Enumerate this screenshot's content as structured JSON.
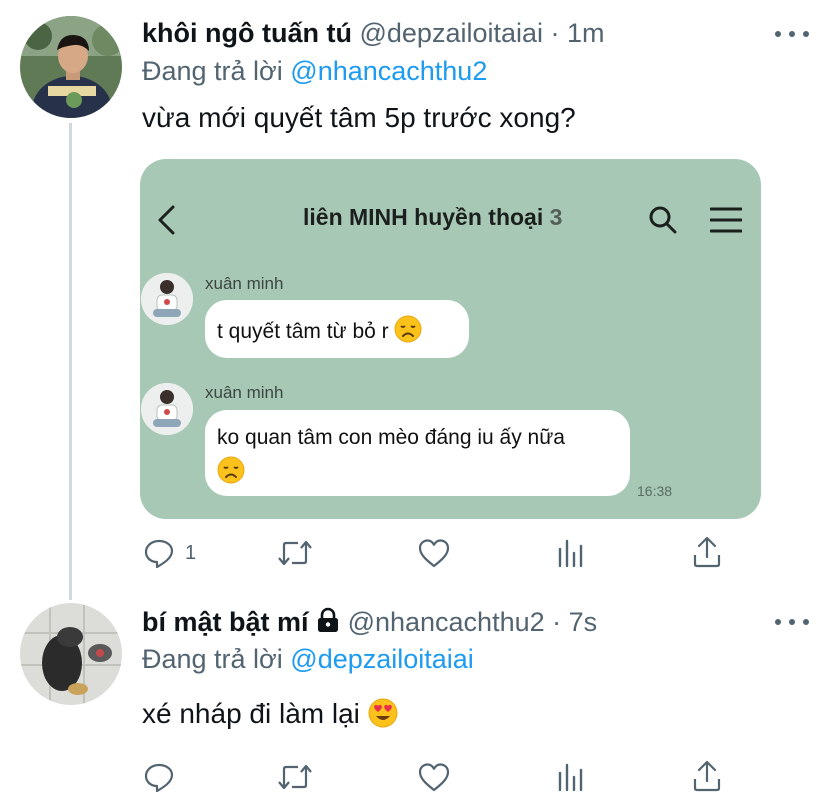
{
  "tweets": [
    {
      "author_name": "khôi ngô tuấn tú",
      "handle": "@depzailoitaiai",
      "separator": "·",
      "time": "1m",
      "replying_prefix": "Đang trả lời",
      "replying_to": "@nhancachthu2",
      "text": "vừa mới quyết tâm 5p trước xong?",
      "actions": {
        "reply_count": "1",
        "retweet_count": "",
        "like_count": ""
      }
    },
    {
      "author_name": "bí mật bật mí",
      "handle": "@nhancachthu2",
      "separator": "·",
      "time": "7s",
      "replying_prefix": "Đang trả lời",
      "replying_to": "@depzailoitaiai",
      "text": "xé nháp đi làm lại",
      "actions": {
        "reply_count": "",
        "retweet_count": "",
        "like_count": ""
      }
    }
  ],
  "chat": {
    "title": "liên MINH huyền thoại",
    "member_count": "3",
    "messages": [
      {
        "sender": "xuân minh",
        "lines": [
          "t quyết tâm từ bỏ r"
        ]
      },
      {
        "sender": "xuân minh",
        "lines": [
          "ko quan tâm con mèo đáng iu ấy nữa"
        ],
        "time": "16:38"
      }
    ]
  },
  "icons": {
    "more": "more-horizontal-icon",
    "reply": "reply-icon",
    "retweet": "retweet-icon",
    "like": "heart-icon",
    "analytics": "analytics-icon",
    "share": "share-icon",
    "lock": "lock-icon",
    "back": "chevron-left-icon",
    "search": "search-icon",
    "menu": "hamburger-menu-icon",
    "sad_emoji": "disappointed-face-emoji",
    "love_emoji": "heart-eyes-emoji"
  },
  "colors": {
    "link": "#1d9bf0",
    "secondary_text": "#536471",
    "chat_background": "#a7c8b5"
  }
}
